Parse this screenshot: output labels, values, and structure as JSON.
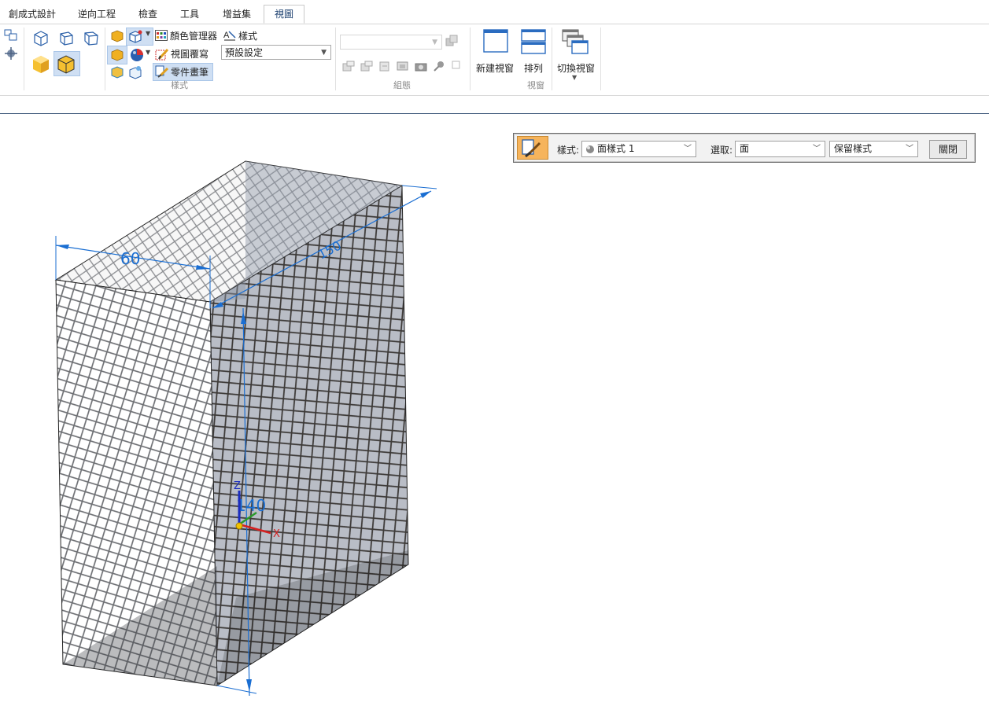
{
  "tabs": [
    {
      "label": "創成式設計"
    },
    {
      "label": "逆向工程"
    },
    {
      "label": "檢查"
    },
    {
      "label": "工具"
    },
    {
      "label": "增益集"
    },
    {
      "label": "視圖"
    }
  ],
  "ribbon": {
    "style_group": {
      "color_manager": "顏色管理器",
      "styles": "樣式",
      "view_override": "視圖覆寫",
      "part_painter": "零件畫筆",
      "preset_combo_value": "預設設定",
      "label": "樣式"
    },
    "combo_group": {
      "label": "組態"
    },
    "window_group": {
      "new_window": "新建視窗",
      "arrange": "排列",
      "switch_window": "切換視窗",
      "label": "視窗"
    }
  },
  "part_painter_bar": {
    "style_label": "樣式:",
    "style_value": "面樣式 1",
    "select_label": "選取:",
    "select_value": "面",
    "keep_value": "保留樣式",
    "close_button": "關閉"
  },
  "model": {
    "dim_width": "60",
    "dim_depth": "150",
    "dim_height": "140",
    "axis_x": "X",
    "axis_z": "Z"
  },
  "colors": {
    "accent_blue": "#1a6ed2",
    "part_painter_active": "#f6b45c",
    "divider": "#3b5578"
  }
}
